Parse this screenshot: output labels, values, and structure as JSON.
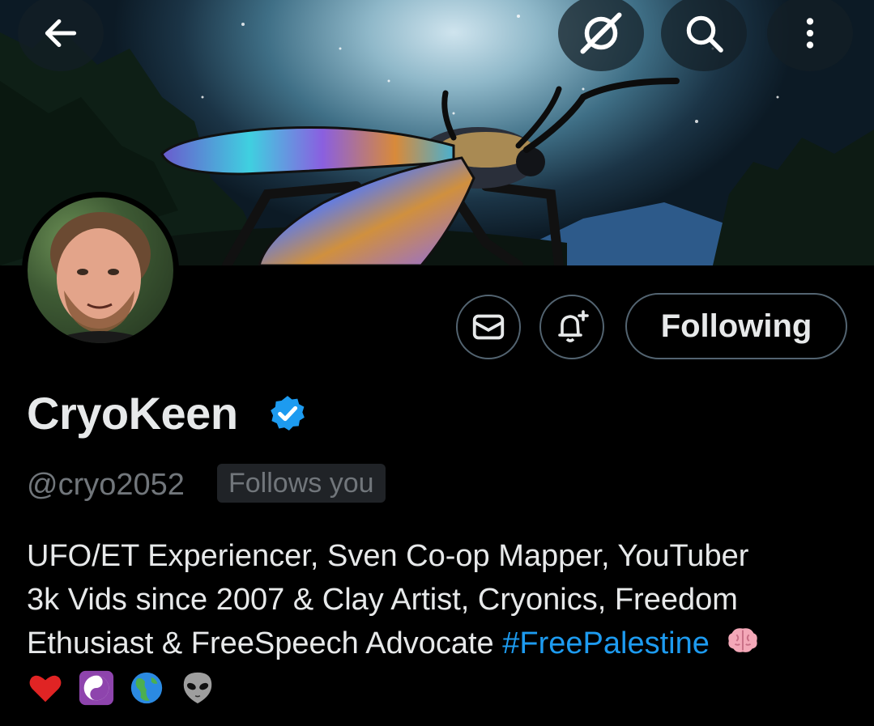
{
  "header": {
    "back_icon": "arrow-left-icon",
    "grok_icon": "grok-icon",
    "search_icon": "search-icon",
    "more_icon": "more-vertical-icon"
  },
  "profile": {
    "display_name": "CryoKeen",
    "handle": "@cryo2052",
    "follows_you": "Follows you",
    "verified": true,
    "follow_label": "Following",
    "message_icon": "mail-icon",
    "notify_icon": "bell-plus-icon"
  },
  "bio": {
    "line1": "UFO/ET Experiencer, Sven Co-op Mapper, YouTuber",
    "line2": "3k Vids since 2007 & Clay Artist, Cryonics, Freedom",
    "line3_text": "Ethusiast & FreeSpeech Advocate ",
    "hashtag": "#FreePalestine",
    "emojis_line3": [
      "brain-emoji"
    ],
    "emojis_line4": [
      "red-heart-emoji",
      "yin-yang-emoji",
      "globe-americas-emoji",
      "alien-emoji"
    ]
  },
  "colors": {
    "background": "#000000",
    "text": "#e7e9ea",
    "muted": "#71767b",
    "border": "#536471",
    "link": "#1d9bf0",
    "verified": "#1d9bf0"
  }
}
